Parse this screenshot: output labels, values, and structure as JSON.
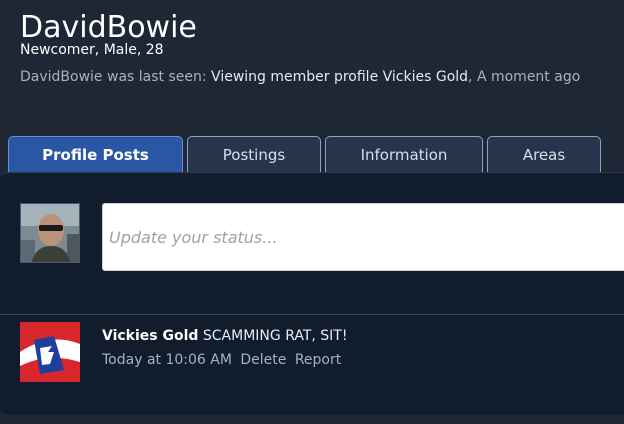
{
  "profile": {
    "username": "DavidBowie",
    "meta": "Newcomer, Male, 28",
    "last_seen_prefix": "DavidBowie was last seen:",
    "last_seen_activity": "Viewing member profile",
    "last_seen_target": "Vickies Gold",
    "last_seen_time": "A moment ago"
  },
  "tabs": [
    {
      "label": "Profile Posts",
      "active": true
    },
    {
      "label": "Postings",
      "active": false
    },
    {
      "label": "Information",
      "active": false
    },
    {
      "label": "Areas",
      "active": false
    }
  ],
  "status": {
    "placeholder": "Update your status..."
  },
  "posts": [
    {
      "author": "Vickies Gold",
      "message": "SCAMMING RAT, SIT!",
      "time": "Today at 10:06 AM",
      "actions": [
        "Delete",
        "Report"
      ]
    }
  ],
  "colors": {
    "background": "#1d2736",
    "panel": "#111c2c",
    "active_tab": "#2a56a6"
  }
}
